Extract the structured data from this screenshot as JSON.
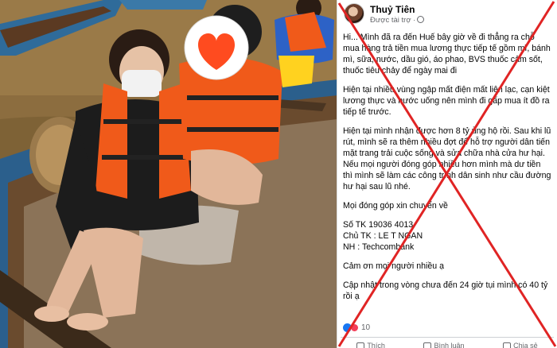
{
  "post": {
    "author": "Thuỷ Tiên",
    "sponsored": "Được tài trợ ·",
    "paragraphs": [
      "Hi... Mình đã ra đến Huế bây giờ về đi thẳng ra chỗ mua hàng trả tiền mua lương thực tiếp tế gồm mì, bánh mì, sữa, nước, dầu gió, áo phao, BVS thuốc cảm sốt, thuốc tiêu chảy để ngày mai đi",
      "Hiện tại nhiều vùng ngập mất điện mất liên lạc, cạn kiệt lương thực và nước uống nên mình đi gấp mua ít đồ ra tiếp tế trước.",
      "Hiện tại mình nhận được hơn 8 tỷ ủng hộ rồi. Sau khi lũ rút, mình sẽ ra thêm nhiều đợt để hỗ trợ người dân tiến mặt trang trải cuộc sống và sửa chữa nhà cửa hư hại. Nếu mọi người đóng góp nhiều hơn mình mà dư tiền thì mình sẽ làm các công trình dân sinh như cầu đường hư hại sau lũ nhé.",
      "Mọi đóng góp xin chuyển về"
    ],
    "bank": {
      "account": "Số TK 19036          4013",
      "holder": "Chủ TK : LE T        NGAN",
      "bank_name": "NH : Techcombank"
    },
    "thanks": "Cảm ơn mọi người nhiều ạ",
    "update_line1": "Cập nhật trong vòng chưa đến 24 giờ tụi mình có 40 tỷ",
    "update_line2": "rồi ạ",
    "reaction_count": "10",
    "actions": [
      "Thích",
      "Bình luận",
      "Chia sẻ"
    ]
  },
  "colors": {
    "cross": "#e02424",
    "vest": "#f05a1a",
    "water": "#8a6a3a",
    "boat": "#2f6b9a"
  },
  "icons": {
    "heart_badge": "heart-icon",
    "globe": "globe-icon"
  }
}
